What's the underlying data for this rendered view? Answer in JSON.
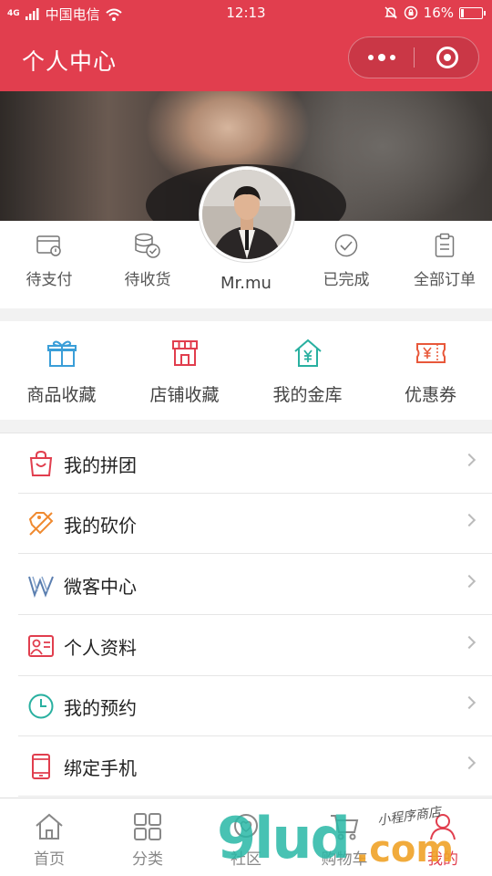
{
  "status_bar": {
    "network": "4G",
    "carrier": "中国电信",
    "time": "12:13",
    "battery_text": "16%",
    "battery_level": 0.16
  },
  "nav": {
    "title": "个人中心",
    "accent": "#e13e4e"
  },
  "profile": {
    "username": "Mr.mu"
  },
  "orders": [
    {
      "label": "待支付",
      "icon": "wallet-icon"
    },
    {
      "label": "待收货",
      "icon": "coins-icon"
    },
    {
      "label": "已完成",
      "icon": "check-circle-icon"
    },
    {
      "label": "全部订单",
      "icon": "clipboard-icon"
    }
  ],
  "quick_links": [
    {
      "label": "商品收藏",
      "icon": "gift-icon",
      "color": "#3a9ed8"
    },
    {
      "label": "店铺收藏",
      "icon": "storefront-icon",
      "color": "#e13e4e"
    },
    {
      "label": "我的金库",
      "icon": "house-yen-icon",
      "color": "#29b0a0"
    },
    {
      "label": "优惠券",
      "icon": "coupon-icon",
      "color": "#e8583a"
    }
  ],
  "menu": [
    {
      "label": "我的拼团",
      "icon": "shopping-bag-icon",
      "color": "#e13e4e"
    },
    {
      "label": "我的砍价",
      "icon": "price-tag-icon",
      "color": "#f08a30"
    },
    {
      "label": "微客中心",
      "icon": "w-logo-icon",
      "color": "#5b7fb0"
    },
    {
      "label": "个人资料",
      "icon": "id-card-icon",
      "color": "#e13e4e"
    },
    {
      "label": "我的预约",
      "icon": "clock-icon",
      "color": "#29b0a0"
    },
    {
      "label": "绑定手机",
      "icon": "phone-icon",
      "color": "#e13e4e"
    }
  ],
  "tabs": [
    {
      "label": "首页",
      "icon": "home-icon"
    },
    {
      "label": "分类",
      "icon": "grid-icon"
    },
    {
      "label": "社区",
      "icon": "heart-chat-icon"
    },
    {
      "label": "购物车",
      "icon": "cart-icon"
    },
    {
      "label": "我的",
      "icon": "user-icon",
      "active": true
    }
  ],
  "watermark": {
    "text": "9lud",
    "suffix": ".com",
    "handwriting": "小程序商店"
  }
}
